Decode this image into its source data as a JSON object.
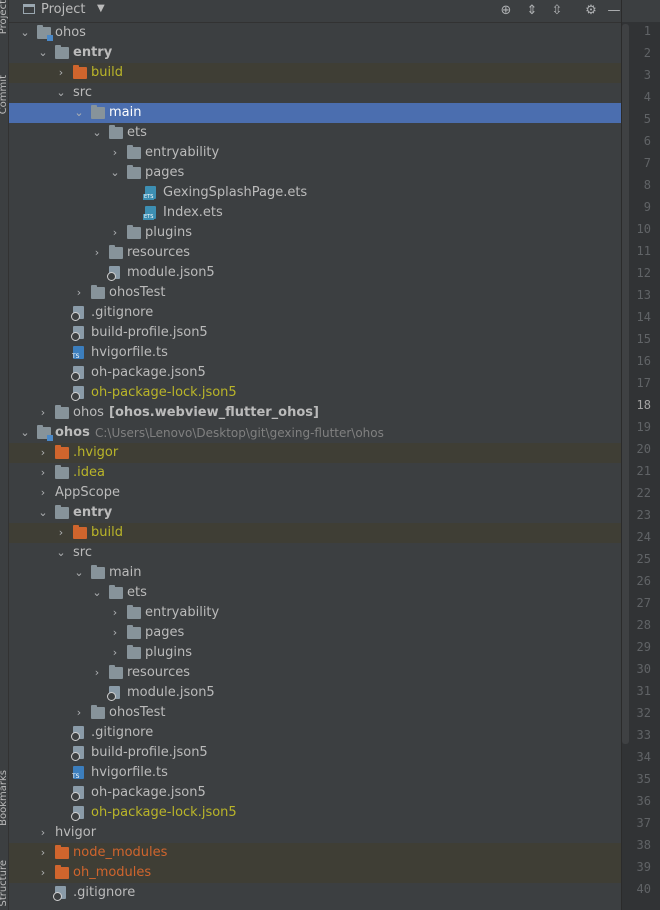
{
  "header": {
    "title": "Project"
  },
  "side_tabs": [
    "Project",
    "Commit",
    "Bookmarks",
    "Structure"
  ],
  "tree": [
    {
      "depth": 0,
      "chev": "down",
      "icon": "module-folder",
      "label": "ohos"
    },
    {
      "depth": 1,
      "chev": "down",
      "icon": "folder",
      "label": "entry",
      "bold": true
    },
    {
      "depth": 2,
      "chev": "right",
      "icon": "folder-orange",
      "label": "build",
      "style": "yellow",
      "excluded": true
    },
    {
      "depth": 2,
      "chev": "down",
      "icon": "none",
      "label": "src"
    },
    {
      "depth": 3,
      "chev": "down",
      "icon": "folder",
      "label": "main",
      "selected": true
    },
    {
      "depth": 4,
      "chev": "down",
      "icon": "folder",
      "label": "ets"
    },
    {
      "depth": 5,
      "chev": "right",
      "icon": "folder",
      "label": "entryability"
    },
    {
      "depth": 5,
      "chev": "down",
      "icon": "folder",
      "label": "pages"
    },
    {
      "depth": 6,
      "chev": "none",
      "icon": "ets",
      "label": "GexingSplashPage.ets"
    },
    {
      "depth": 6,
      "chev": "none",
      "icon": "ets",
      "label": "Index.ets"
    },
    {
      "depth": 5,
      "chev": "right",
      "icon": "folder",
      "label": "plugins"
    },
    {
      "depth": 4,
      "chev": "right",
      "icon": "folder",
      "label": "resources"
    },
    {
      "depth": 4,
      "chev": "none",
      "icon": "json",
      "label": "module.json5"
    },
    {
      "depth": 3,
      "chev": "right",
      "icon": "folder",
      "label": "ohosTest"
    },
    {
      "depth": 2,
      "chev": "none",
      "icon": "json",
      "label": ".gitignore"
    },
    {
      "depth": 2,
      "chev": "none",
      "icon": "json",
      "label": "build-profile.json5"
    },
    {
      "depth": 2,
      "chev": "none",
      "icon": "ts",
      "label": "hvigorfile.ts"
    },
    {
      "depth": 2,
      "chev": "none",
      "icon": "json",
      "label": "oh-package.json5"
    },
    {
      "depth": 2,
      "chev": "none",
      "icon": "json",
      "label": "oh-package-lock.json5",
      "style": "yellow"
    },
    {
      "depth": 1,
      "chev": "right",
      "icon": "folder",
      "label": "ohos",
      "suffix": "[ohos.webview_flutter_ohos]"
    },
    {
      "depth": 0,
      "chev": "down",
      "icon": "module-folder",
      "label": "ohos",
      "bold": true,
      "path": "C:\\Users\\Lenovo\\Desktop\\git\\gexing-flutter\\ohos"
    },
    {
      "depth": 1,
      "chev": "right",
      "icon": "folder-orange",
      "label": ".hvigor",
      "style": "yellow",
      "excluded": true
    },
    {
      "depth": 1,
      "chev": "right",
      "icon": "folder",
      "label": ".idea",
      "style": "yellow"
    },
    {
      "depth": 1,
      "chev": "right",
      "icon": "none",
      "label": "AppScope"
    },
    {
      "depth": 1,
      "chev": "down",
      "icon": "folder",
      "label": "entry",
      "bold": true
    },
    {
      "depth": 2,
      "chev": "right",
      "icon": "folder-orange",
      "label": "build",
      "style": "yellow",
      "excluded": true
    },
    {
      "depth": 2,
      "chev": "down",
      "icon": "none",
      "label": "src"
    },
    {
      "depth": 3,
      "chev": "down",
      "icon": "folder",
      "label": "main"
    },
    {
      "depth": 4,
      "chev": "down",
      "icon": "folder",
      "label": "ets"
    },
    {
      "depth": 5,
      "chev": "right",
      "icon": "folder",
      "label": "entryability"
    },
    {
      "depth": 5,
      "chev": "right",
      "icon": "folder",
      "label": "pages"
    },
    {
      "depth": 5,
      "chev": "right",
      "icon": "folder",
      "label": "plugins"
    },
    {
      "depth": 4,
      "chev": "right",
      "icon": "folder",
      "label": "resources"
    },
    {
      "depth": 4,
      "chev": "none",
      "icon": "json",
      "label": "module.json5"
    },
    {
      "depth": 3,
      "chev": "right",
      "icon": "folder",
      "label": "ohosTest"
    },
    {
      "depth": 2,
      "chev": "none",
      "icon": "json",
      "label": ".gitignore"
    },
    {
      "depth": 2,
      "chev": "none",
      "icon": "json",
      "label": "build-profile.json5"
    },
    {
      "depth": 2,
      "chev": "none",
      "icon": "ts",
      "label": "hvigorfile.ts"
    },
    {
      "depth": 2,
      "chev": "none",
      "icon": "json",
      "label": "oh-package.json5"
    },
    {
      "depth": 2,
      "chev": "none",
      "icon": "json",
      "label": "oh-package-lock.json5",
      "style": "yellow"
    },
    {
      "depth": 1,
      "chev": "right",
      "icon": "none",
      "label": "hvigor"
    },
    {
      "depth": 1,
      "chev": "right",
      "icon": "folder-orange",
      "label": "node_modules",
      "style": "orange",
      "excluded": true
    },
    {
      "depth": 1,
      "chev": "right",
      "icon": "folder-orange",
      "label": "oh_modules",
      "style": "orange",
      "excluded": true
    },
    {
      "depth": 1,
      "chev": "none",
      "icon": "json",
      "label": ".gitignore"
    }
  ],
  "line_numbers": [
    "1",
    "2",
    "3",
    "4",
    "5",
    "6",
    "7",
    "8",
    "9",
    "10",
    "11",
    "12",
    "13",
    "14",
    "15",
    "16",
    "17",
    "18",
    "19",
    "20",
    "21",
    "22",
    "23",
    "24",
    "25",
    "26",
    "27",
    "28",
    "29",
    "30",
    "31",
    "32",
    "33",
    "34",
    "35",
    "36",
    "37",
    "38",
    "39",
    "40"
  ],
  "current_line": "18"
}
